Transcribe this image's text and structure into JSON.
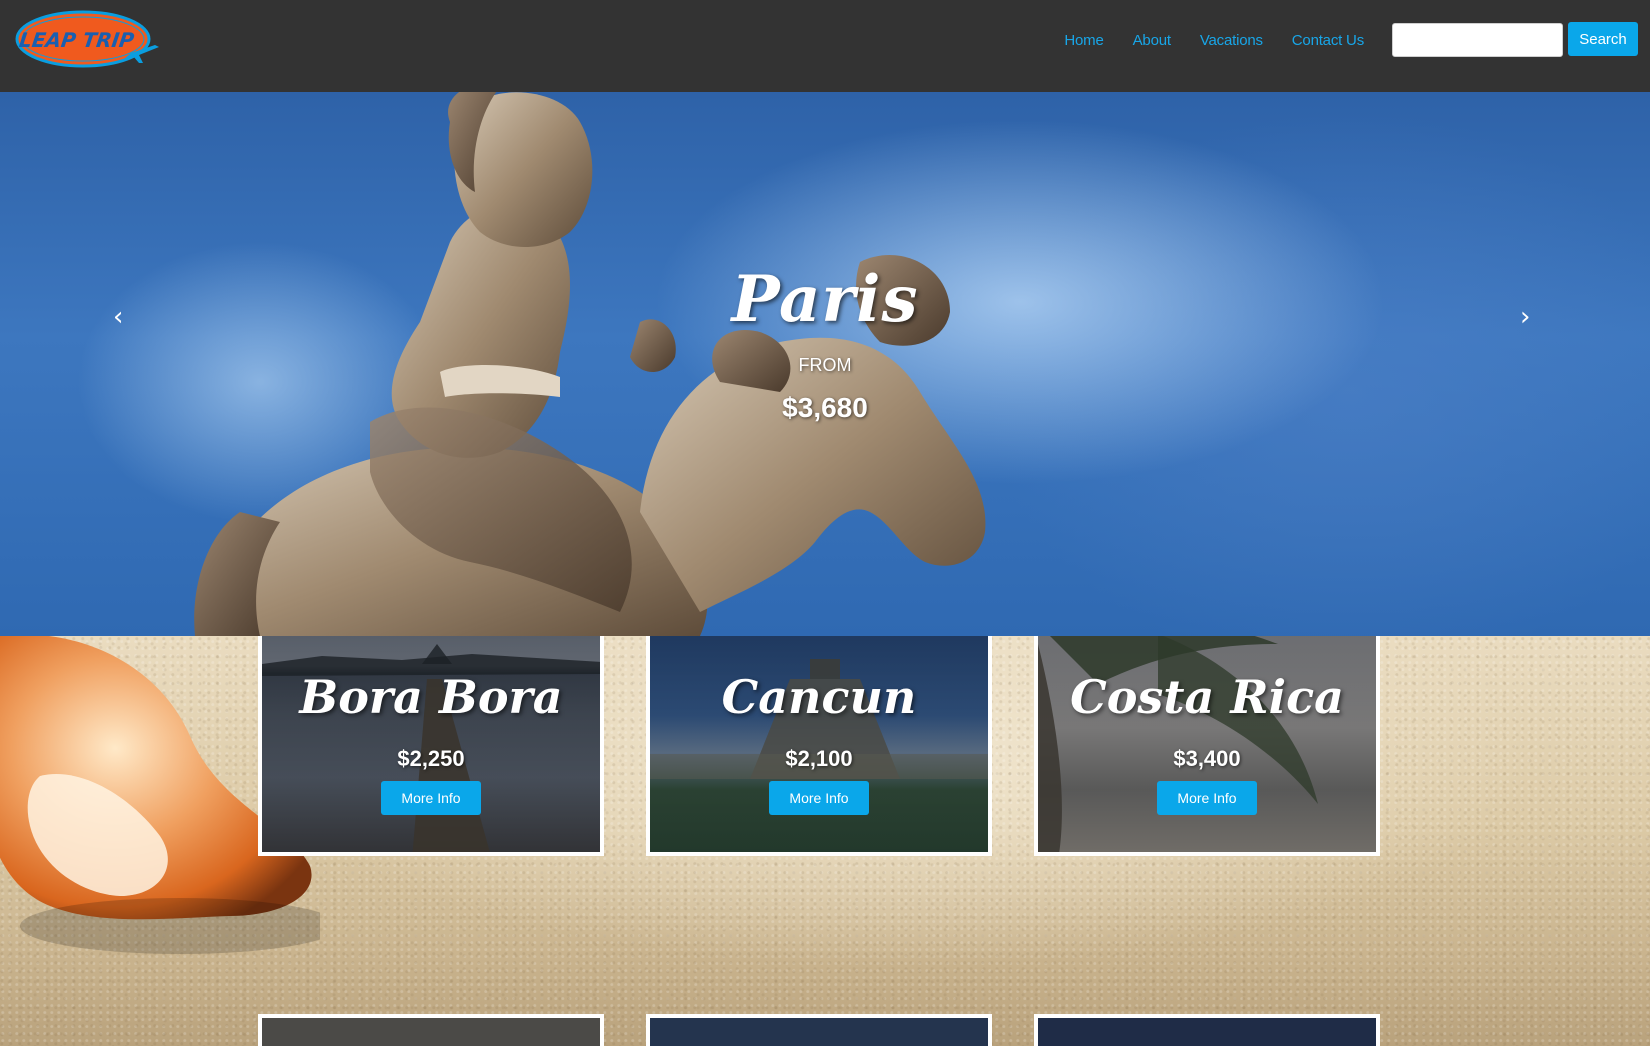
{
  "brand": {
    "logo_text": "LEAP TRIP",
    "colors": {
      "orange": "#f05a1e",
      "blue": "#0aa7ea",
      "nav_bg": "#333333"
    }
  },
  "nav": {
    "links": [
      "Home",
      "About",
      "Vacations",
      "Contact Us"
    ],
    "search": {
      "placeholder": "",
      "value": "",
      "button_label": "Search"
    }
  },
  "hero": {
    "city": "Paris",
    "from_label": "FROM",
    "price": "$3,680",
    "prev_icon": "chevron-left-icon",
    "next_icon": "chevron-right-icon",
    "prev_glyph": "‹",
    "next_glyph": "›"
  },
  "destinations": [
    {
      "name": "Bora Bora",
      "price": "$2,250",
      "button_label": "More Info"
    },
    {
      "name": "Cancun",
      "price": "$2,100",
      "button_label": "More Info"
    },
    {
      "name": "Costa Rica",
      "price": "$3,400",
      "button_label": "More Info"
    }
  ]
}
